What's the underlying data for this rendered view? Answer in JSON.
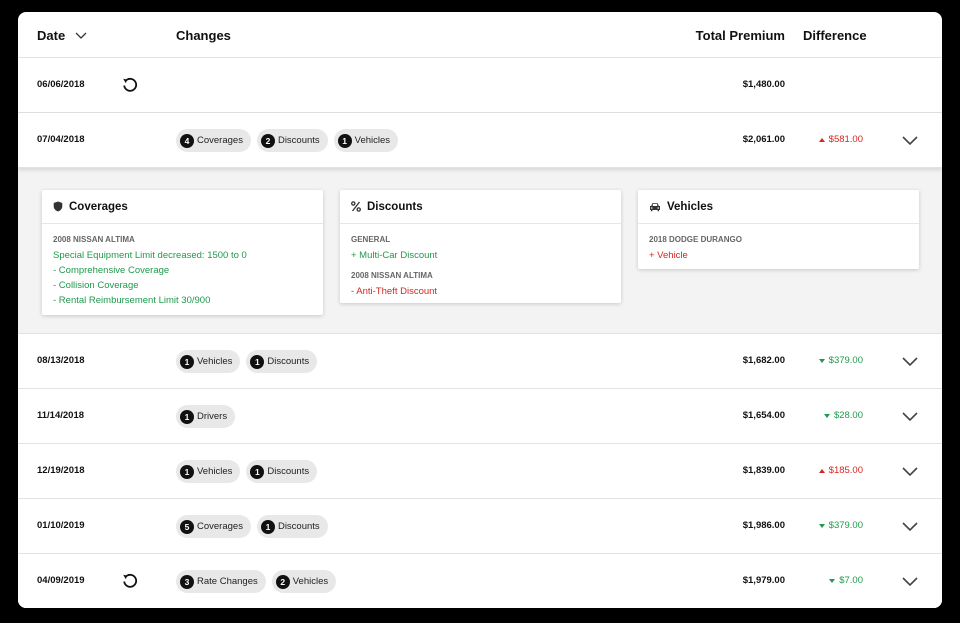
{
  "header": {
    "date": "Date",
    "changes": "Changes",
    "total_premium": "Total Premium",
    "difference": "Difference"
  },
  "colors": {
    "increase": "#d7261e",
    "decrease": "#1e9a4a",
    "chip_bg": "#e8e8e8"
  },
  "rows": [
    {
      "date": "06/06/2018",
      "restore": true,
      "chips": [],
      "premium": "$1,480.00",
      "diff": "",
      "direction": ""
    },
    {
      "date": "07/04/2018",
      "chips": [
        {
          "count": "4",
          "label": "Coverages"
        },
        {
          "count": "2",
          "label": "Discounts"
        },
        {
          "count": "1",
          "label": "Vehicles"
        }
      ],
      "premium": "$2,061.00",
      "diff": "$581.00",
      "direction": "up",
      "expanded": true
    },
    {
      "date": "08/13/2018",
      "chips": [
        {
          "count": "1",
          "label": "Vehicles"
        },
        {
          "count": "1",
          "label": "Discounts"
        }
      ],
      "premium": "$1,682.00",
      "diff": "$379.00",
      "direction": "down"
    },
    {
      "date": "11/14/2018",
      "chips": [
        {
          "count": "1",
          "label": "Drivers"
        }
      ],
      "premium": "$1,654.00",
      "diff": "$28.00",
      "direction": "down"
    },
    {
      "date": "12/19/2018",
      "chips": [
        {
          "count": "1",
          "label": "Vehicles"
        },
        {
          "count": "1",
          "label": "Discounts"
        }
      ],
      "premium": "$1,839.00",
      "diff": "$185.00",
      "direction": "up"
    },
    {
      "date": "01/10/2019",
      "chips": [
        {
          "count": "5",
          "label": "Coverages"
        },
        {
          "count": "1",
          "label": "Discounts"
        }
      ],
      "premium": "$1,986.00",
      "diff": "$379.00",
      "direction": "down"
    },
    {
      "date": "04/09/2019",
      "restore": true,
      "chips": [
        {
          "count": "3",
          "label": "Rate Changes"
        },
        {
          "count": "2",
          "label": "Vehicles"
        }
      ],
      "premium": "$1,979.00",
      "diff": "$7.00",
      "direction": "down"
    }
  ],
  "detail": {
    "coverages": {
      "title": "Coverages",
      "icon": "shield-icon",
      "vehicle": "2008 NISSAN ALTIMA",
      "lines": [
        "Special Equipment Limit decreased: 1500 to 0",
        "- Comprehensive Coverage",
        "- Collision Coverage",
        "- Rental Reimbursement Limit 30/900"
      ]
    },
    "discounts": {
      "title": "Discounts",
      "icon": "percent-icon",
      "group1": "GENERAL",
      "item1": "+ Multi-Car Discount",
      "group2": "2008 NISSAN ALTIMA",
      "item2": "- Anti-Theft Discount"
    },
    "vehicles": {
      "title": "Vehicles",
      "icon": "car-icon",
      "vehicle": "2018 DODGE DURANGO",
      "item": "+ Vehicle"
    }
  }
}
